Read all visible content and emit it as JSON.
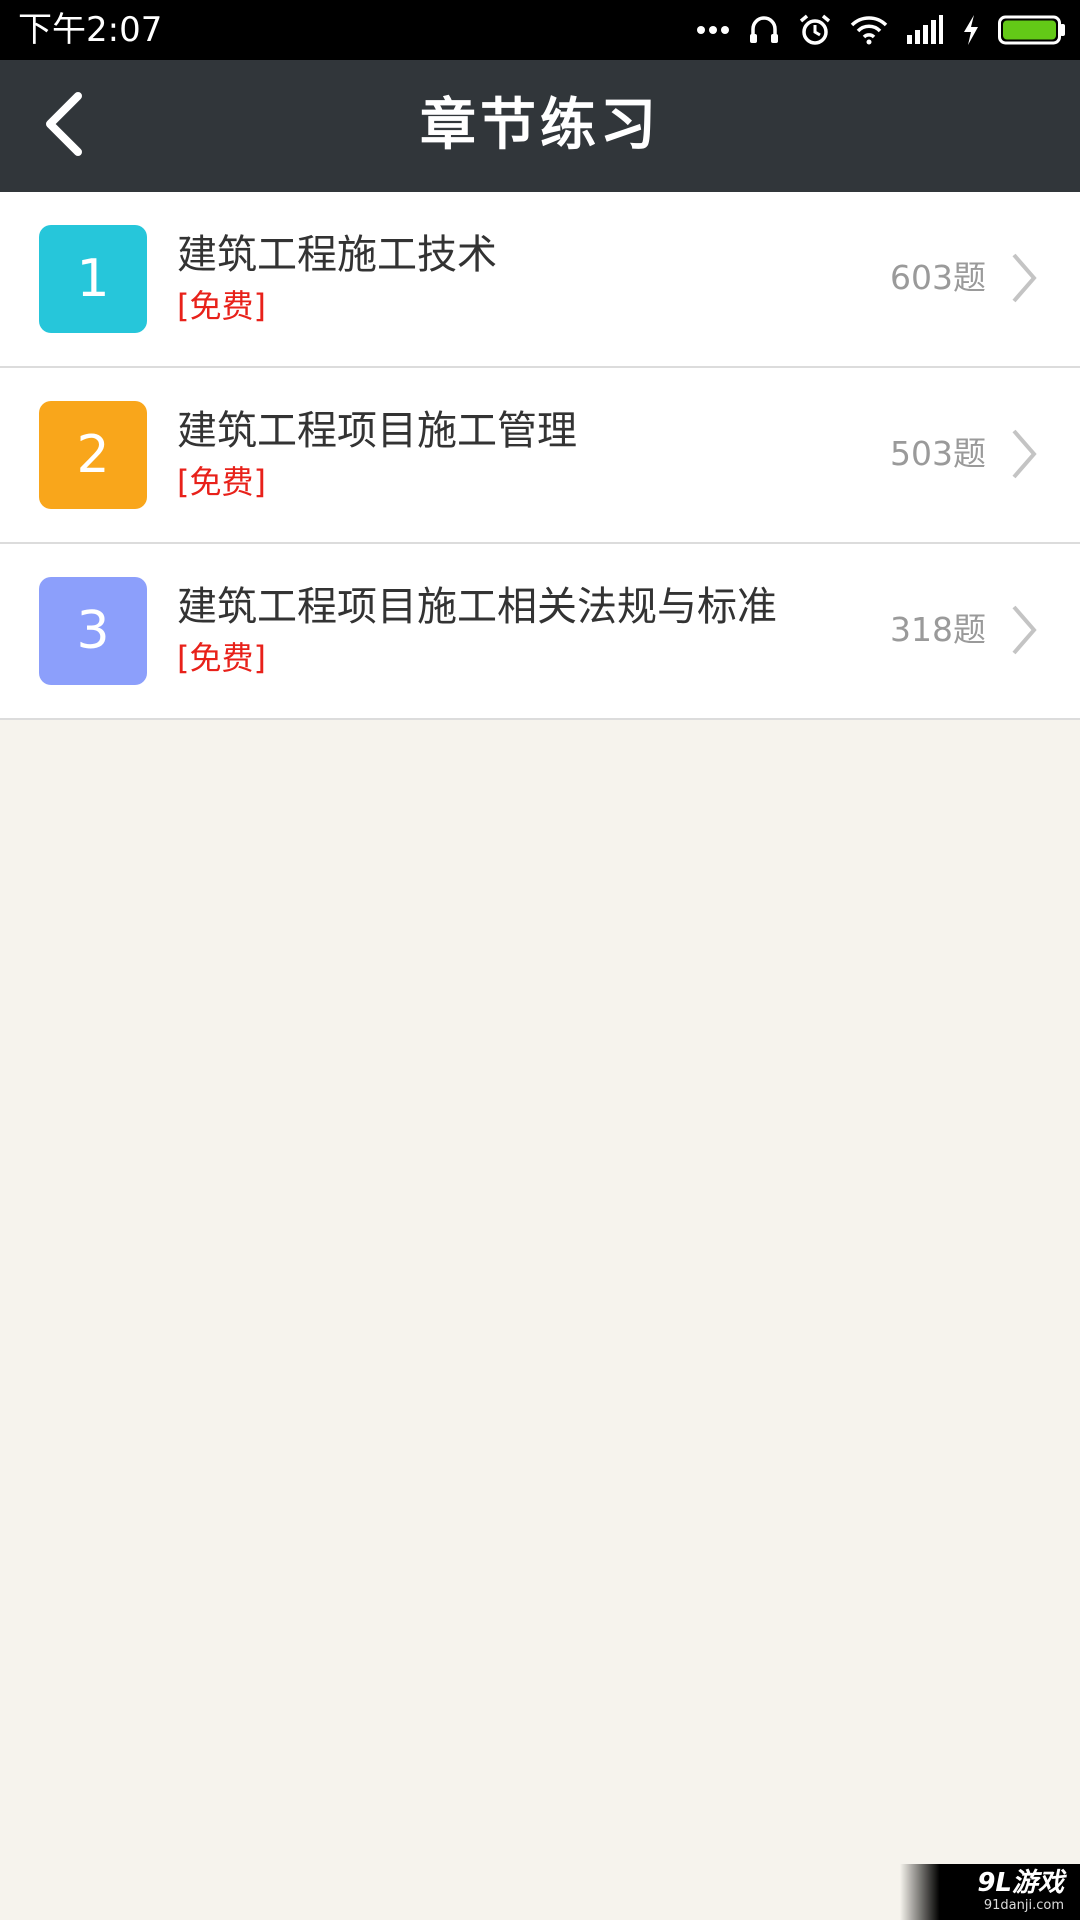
{
  "status_bar": {
    "time": "下午2:07",
    "icons": [
      "more-dots-icon",
      "headset-icon",
      "alarm-icon",
      "wifi-icon",
      "signal-icon",
      "charging-icon",
      "battery-icon"
    ]
  },
  "header": {
    "title": "章节练习",
    "back_icon": "back-arrow-icon",
    "background": "#31363a"
  },
  "chapters": [
    {
      "number": "1",
      "name": "建筑工程施工技术",
      "tag": "[免费]",
      "count": "603题",
      "color": "#26c6da"
    },
    {
      "number": "2",
      "name": "建筑工程项目施工管理",
      "tag": "[免费]",
      "count": "503题",
      "color": "#f9a61b"
    },
    {
      "number": "3",
      "name": "建筑工程项目施工相关法规与标准",
      "tag": "[免费]",
      "count": "318题",
      "color": "#8c9ffb"
    }
  ],
  "colors": {
    "tag": "#e8211a",
    "page_background": "#f6f3ed"
  },
  "watermark": {
    "main": "9L游戏",
    "sub": "91danji.com"
  }
}
